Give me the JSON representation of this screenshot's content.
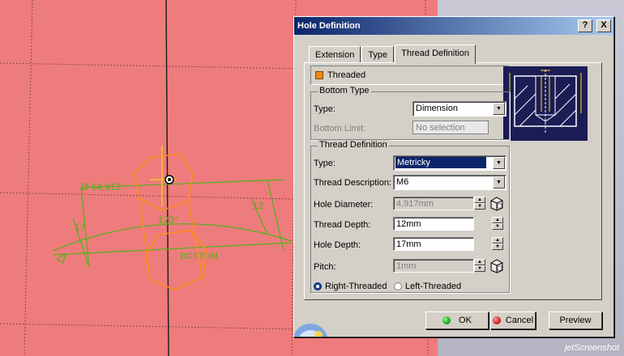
{
  "viewport": {
    "sketch_labels": {
      "diameter": "Ø 64,912",
      "angle": "120°",
      "right_dim": "12",
      "left_dim": "17",
      "bottom": "BOTTOM"
    }
  },
  "watermark": "jetScreenshot",
  "dialog": {
    "title": "Hole Definition",
    "help_label": "?",
    "close_label": "X",
    "tabs": [
      "Extension",
      "Type",
      "Thread Definition"
    ],
    "active_tab": "Thread Definition",
    "threaded": {
      "label": "Threaded",
      "checked": true
    },
    "bottom_type": {
      "title": "Bottom Type",
      "type_label": "Type:",
      "type_value": "Dimension",
      "limit_label": "Bottom Limit:",
      "limit_value": "No selection"
    },
    "thread_definition": {
      "title": "Thread Definition",
      "type_label": "Type:",
      "type_value": "Metricky",
      "description_label": "Thread Description:",
      "description_value": "M6",
      "hole_diameter_label": "Hole Diameter:",
      "hole_diameter_value": "4,917mm",
      "thread_depth_label": "Thread Depth:",
      "thread_depth_value": "12mm",
      "hole_depth_label": "Hole Depth:",
      "hole_depth_value": "17mm",
      "pitch_label": "Pitch:",
      "pitch_value": "1mm",
      "right_threaded_label": "Right-Threaded",
      "left_threaded_label": "Left-Threaded",
      "selected_direction": "Right-Threaded"
    },
    "buttons": {
      "ok": "OK",
      "cancel": "Cancel",
      "preview": "Preview"
    }
  },
  "colors": {
    "viewport_bg": "#ef7c7c",
    "sketch_green": "#4fb31a",
    "highlight_orange": "#ff8c1a",
    "title_bar": "#0a246a",
    "ok_green": "#1ea81e",
    "cancel_red": "#d42020"
  }
}
